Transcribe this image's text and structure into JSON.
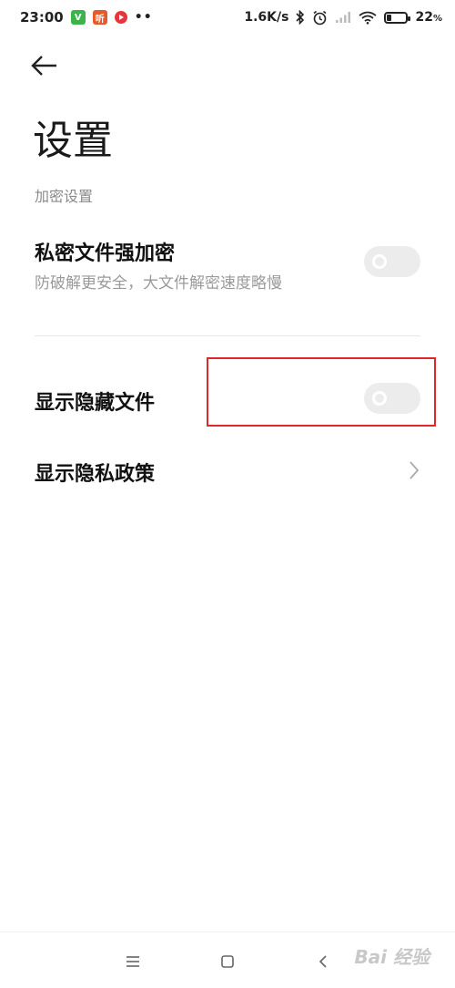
{
  "status_bar": {
    "time": "23:00",
    "badge_green": "V",
    "badge_orange": "听",
    "dots": "••",
    "speed": "1.6K/s",
    "battery_percent": 22,
    "battery_text": "22",
    "percent_sign": "%"
  },
  "header": {
    "title": "设置"
  },
  "section": {
    "label": "加密设置"
  },
  "settings": [
    {
      "title": "私密文件强加密",
      "subtitle": "防破解更安全，大文件解密速度略慢",
      "toggle_on": false
    },
    {
      "title": "显示隐藏文件",
      "toggle_on": false
    },
    {
      "title": "显示隐私政策"
    }
  ],
  "watermark": "Bai 经验",
  "colors": {
    "highlight": "#e0282c",
    "toggle_off": "#ececec",
    "subtitle": "#9a9a9a",
    "section_label": "#8a8a8a"
  },
  "icons": {
    "back": "arrow-left-icon",
    "chevron": "chevron-right-icon",
    "nav_menu": "menu-icon",
    "nav_home": "square-home-icon",
    "nav_back": "chevron-left-icon"
  }
}
